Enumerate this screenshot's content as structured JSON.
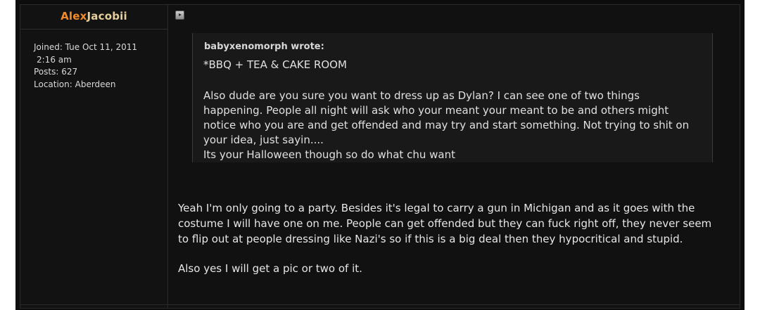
{
  "post": {
    "author": {
      "name_part1": "Alex",
      "name_part2": "Jacobii",
      "joined_line1": "Joined: Tue Oct 11, 2011",
      "joined_line2": "2:16 am",
      "posts": "Posts: 627",
      "location": "Location: Aberdeen"
    },
    "post_icon": "post-icon",
    "quote": {
      "author": "babyxenomorph wrote:",
      "lines": [
        "*BBQ + TEA & CAKE ROOM",
        "Also dude are you sure you want to dress up as Dylan? I can see one of two things",
        " happening. People all night will ask who your meant your meant to be and others might",
        " notice who you are and get offended and may try and start something. Not trying to shit on",
        " your idea, just sayin....",
        "Its your Halloween though so do what chu want"
      ]
    },
    "reply": {
      "lines": [
        "Yeah I'm only going to a party. Besides it's legal to carry a gun in Michigan and as it goes with the",
        " costume I will have one on me. People can get offended but they can fuck right off, they never seem",
        " to flip out at people dressing like Nazi's so if this is a big deal then they hypocritical and stupid.",
        "Also yes I will get a pic or two of it."
      ]
    }
  },
  "colors": {
    "background": "#0d0d0d",
    "name_first": "#f08a2a",
    "name_rest": "#e7cf9c",
    "text": "#e0e0e0"
  }
}
